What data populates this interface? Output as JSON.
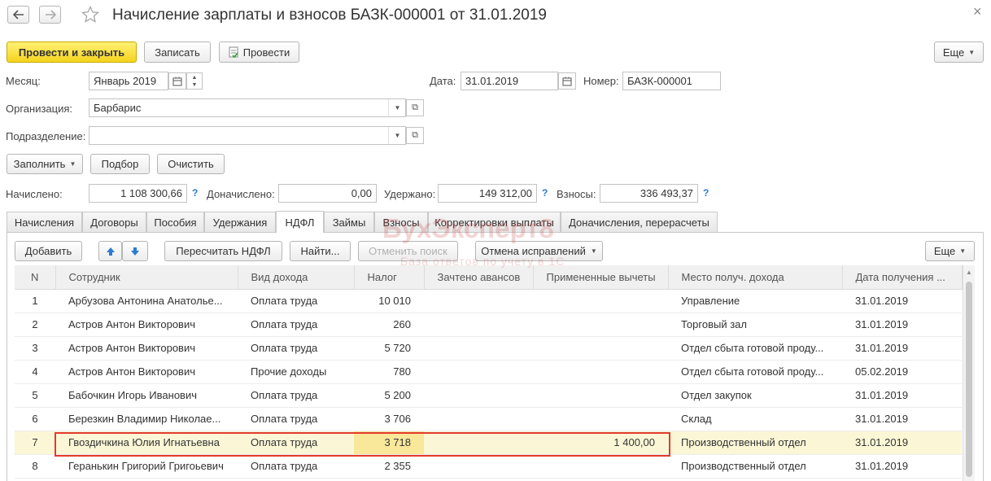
{
  "window": {
    "title": "Начисление зарплаты и взносов БАЗК-000001 от 31.01.2019",
    "close": "×"
  },
  "toolbar": {
    "post_close": "Провести и закрыть",
    "save": "Записать",
    "post": "Провести",
    "more": "Еще"
  },
  "header": {
    "month_label": "Месяц:",
    "month_value": "Январь 2019",
    "date_label": "Дата:",
    "date_value": "31.01.2019",
    "number_label": "Номер:",
    "number_value": "БАЗК-000001",
    "org_label": "Организация:",
    "org_value": "Барбарис",
    "dept_label": "Подразделение:",
    "dept_value": ""
  },
  "actions": {
    "fill": "Заполнить",
    "select": "Подбор",
    "clear": "Очистить"
  },
  "totals": {
    "accrued_label": "Начислено:",
    "accrued_value": "1 108 300,66",
    "extra_label": "Доначислено:",
    "extra_value": "0,00",
    "withheld_label": "Удержано:",
    "withheld_value": "149 312,00",
    "contrib_label": "Взносы:",
    "contrib_value": "336 493,37",
    "help": "?"
  },
  "tabs": [
    "Начисления",
    "Договоры",
    "Пособия",
    "Удержания",
    "НДФЛ",
    "Займы",
    "Взносы",
    "Корректировки выплаты",
    "Доначисления, перерасчеты"
  ],
  "tab_toolbar": {
    "add": "Добавить",
    "recalc": "Пересчитать НДФЛ",
    "find": "Найти...",
    "cancel_search": "Отменить поиск",
    "cancel_fix": "Отмена исправлений",
    "more": "Еще"
  },
  "grid": {
    "columns": [
      "N",
      "Сотрудник",
      "Вид дохода",
      "Налог",
      "Зачтено авансов",
      "Примененные вычеты",
      "Место получ. дохода",
      "Дата получения ..."
    ],
    "rows": [
      [
        "1",
        "Арбузова Антонина Анатолье...",
        "Оплата труда",
        "10 010",
        "",
        "",
        "Управление",
        "31.01.2019"
      ],
      [
        "2",
        "Астров Антон Викторович",
        "Оплата труда",
        "260",
        "",
        "",
        "Торговый зал",
        "31.01.2019"
      ],
      [
        "3",
        "Астров Антон Викторович",
        "Оплата труда",
        "5 720",
        "",
        "",
        "Отдел сбыта готовой проду...",
        "31.01.2019"
      ],
      [
        "4",
        "Астров Антон Викторович",
        "Прочие доходы",
        "780",
        "",
        "",
        "Отдел сбыта готовой проду...",
        "05.02.2019"
      ],
      [
        "5",
        "Бабочкин Игорь Иванович",
        "Оплата труда",
        "5 200",
        "",
        "",
        "Отдел закупок",
        "31.01.2019"
      ],
      [
        "6",
        "Березкин Владимир Николае...",
        "Оплата труда",
        "3 706",
        "",
        "",
        "Склад",
        "31.01.2019"
      ],
      [
        "7",
        "Гвоздичкина Юлия Игнатьевна",
        "Оплата труда",
        "3 718",
        "",
        "1 400,00",
        "Производственный отдел",
        "31.01.2019"
      ],
      [
        "8",
        "Геранькин Григорий Григоьевич",
        "Оплата труда",
        "2 355",
        "",
        "",
        "Производственный отдел",
        "31.01.2019"
      ]
    ],
    "selected_row": 7
  },
  "watermark": {
    "title": "БухЭксперт8",
    "subtitle": "База ответов по учету в 1С"
  },
  "colors": {
    "primary_button": "#f5d31d",
    "highlight_border": "#e23b2e",
    "selected_row": "#fbf7d6",
    "link": "#2b7bd1"
  }
}
